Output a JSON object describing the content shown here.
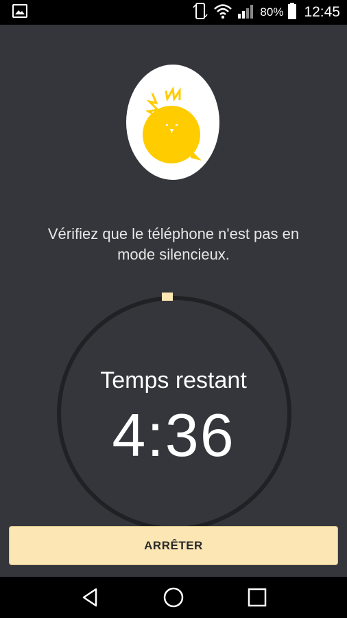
{
  "status_bar": {
    "battery_percent": "80%",
    "time": "12:45",
    "icons": [
      "image-icon",
      "screen-rotation-icon",
      "wifi-icon",
      "signal-icon",
      "battery-icon"
    ]
  },
  "egg": {
    "icon": "egg-chick-icon",
    "colors": {
      "shell": "#ffffff",
      "chick": "#ffcc00"
    }
  },
  "message": "Vérifiez que le téléphone n'est pas en\nmode silencieux.",
  "timer": {
    "label": "Temps restant",
    "value": "4:36",
    "progress": 0.0,
    "colors": {
      "ring": "#202124",
      "marker": "#fbe6b4"
    }
  },
  "stop_button": {
    "label": "ARRÊTER",
    "color": "#fbe6b4"
  },
  "nav_bar": {
    "icons": [
      "back-icon",
      "home-icon",
      "recents-icon"
    ]
  }
}
